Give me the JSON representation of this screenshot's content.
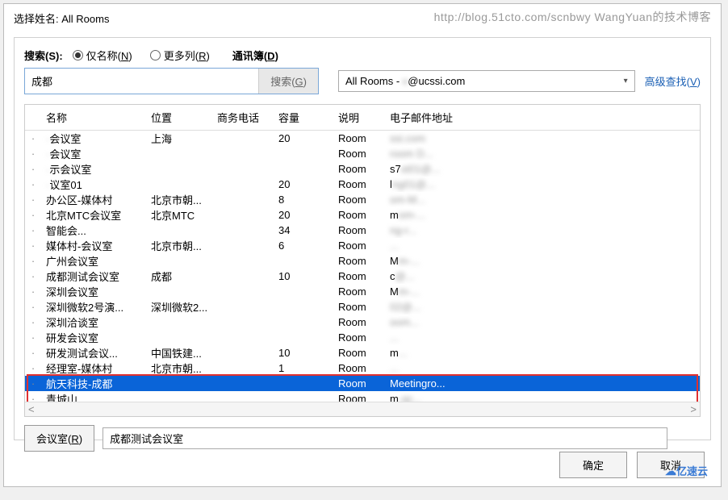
{
  "watermark": "http://blog.51cto.com/scnbwy WangYuan的技术博客",
  "title_prefix": "选择姓名: ",
  "title_value": "All Rooms",
  "search": {
    "label": "搜索(S):",
    "radio_name": "仅名称(N)",
    "radio_more": "更多列(R)",
    "value": "成都",
    "button": "搜索(G)"
  },
  "addressbook": {
    "label": "通讯簿(D)",
    "value_pre": "All Rooms - ",
    "value_blur": "v",
    "value_post": "@ucssi.com"
  },
  "adv_search": "高级查找(V)",
  "columns": {
    "name": "名称",
    "location": "位置",
    "phone": "商务电话",
    "capacity": "容量",
    "desc": "说明",
    "email": "电子邮件地址"
  },
  "rows": [
    {
      "name": "会议室",
      "name_blur": "· ",
      "loc": "上海",
      "cap": "20",
      "desc": "Room",
      "email_blur": "ssi.com"
    },
    {
      "name": "会议室",
      "name_blur": "· ",
      "loc": "",
      "cap": "",
      "desc": "Room",
      "email_blur": "room D..."
    },
    {
      "name": "示会议室",
      "name_blur": "· ",
      "loc": "",
      "cap": "",
      "desc": "Room",
      "email_pre": "s7",
      "email_blur": "st01@..."
    },
    {
      "name": "议室01",
      "name_blur": "· ",
      "loc": "",
      "cap": "20",
      "desc": "Room",
      "email_pre": "l",
      "email_blur": "ng01@..."
    },
    {
      "name": "办公区-媒体村",
      "loc": "北京市朝...",
      "cap": "8",
      "desc": "Room",
      "email_blur": "om-M..."
    },
    {
      "name": "北京MTC会议室",
      "loc": "北京MTC",
      "cap": "20",
      "desc": "Room",
      "email_pre": "m",
      "email_blur": "om-..."
    },
    {
      "name": "智能会...",
      "name_blur": "",
      "loc": "",
      "cap": "34",
      "desc": "Room",
      "email_blur": "ng-r..."
    },
    {
      "name": "媒体村-会议室",
      "loc": "北京市朝...",
      "cap": "6",
      "desc": "Room",
      "email_blur": "..."
    },
    {
      "name": "广州会议室",
      "loc": "",
      "cap": "",
      "desc": "Room",
      "email_pre": "M",
      "email_blur": "m-..."
    },
    {
      "name": "成都测试会议室",
      "loc": "成都",
      "cap": "10",
      "desc": "Room",
      "email_pre": "c",
      "email_blur": "@..."
    },
    {
      "name": "深圳会议室",
      "loc": "",
      "cap": "",
      "desc": "Room",
      "email_pre": "M",
      "email_blur": "m-..."
    },
    {
      "name": "深圳微软2号演...",
      "loc": "深圳微软2...",
      "cap": "",
      "desc": "Room",
      "email_blur": "02@..."
    },
    {
      "name": "深圳洽谈室",
      "loc": "",
      "cap": "",
      "desc": "Room",
      "email_blur": "oom..."
    },
    {
      "name": "研发会议室",
      "loc": "",
      "cap": "",
      "desc": "Room",
      "email_blur": "..."
    },
    {
      "name": "研发测试会议...",
      "loc": "中国铁建...",
      "cap": "10",
      "desc": "Room",
      "email_pre": "m",
      "email_blur": "..."
    },
    {
      "name": "经理室-媒体村",
      "loc": "北京市朝...",
      "cap": "1",
      "desc": "Room",
      "email_blur": "..."
    },
    {
      "name": "航天科技-成都",
      "loc": "",
      "cap": "",
      "desc": "Room",
      "email": "Meetingro...",
      "selected": true
    },
    {
      "name": "青城山",
      "loc": "",
      "cap": "",
      "desc": "Room",
      "email_pre": "m",
      "email_blur": "-qc..."
    }
  ],
  "bottom": {
    "room_btn": "会议室(R)",
    "room_value": "成都测试会议室"
  },
  "footer": {
    "ok": "确定",
    "cancel": "取消"
  },
  "logo": "亿速云"
}
